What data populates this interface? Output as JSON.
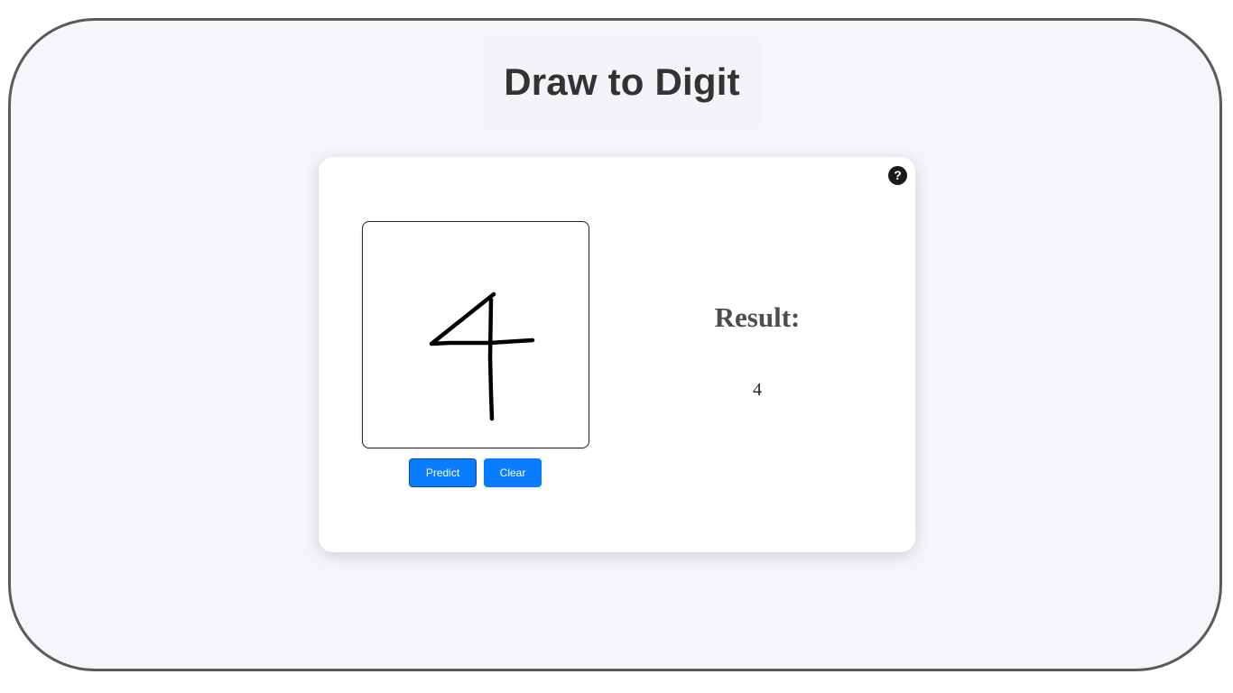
{
  "app": {
    "title": "Draw to Digit"
  },
  "card": {
    "help_icon": "question-circle-icon",
    "help_glyph": "?"
  },
  "drawing": {
    "stroke_color": "#000000",
    "background_color": "#ffffff"
  },
  "actions": {
    "predict_label": "Predict",
    "clear_label": "Clear"
  },
  "result": {
    "label": "Result:",
    "value": "4"
  },
  "colors": {
    "accent": "#0a7cff",
    "page_background": "#f5f6fa",
    "title_text": "#333333"
  }
}
